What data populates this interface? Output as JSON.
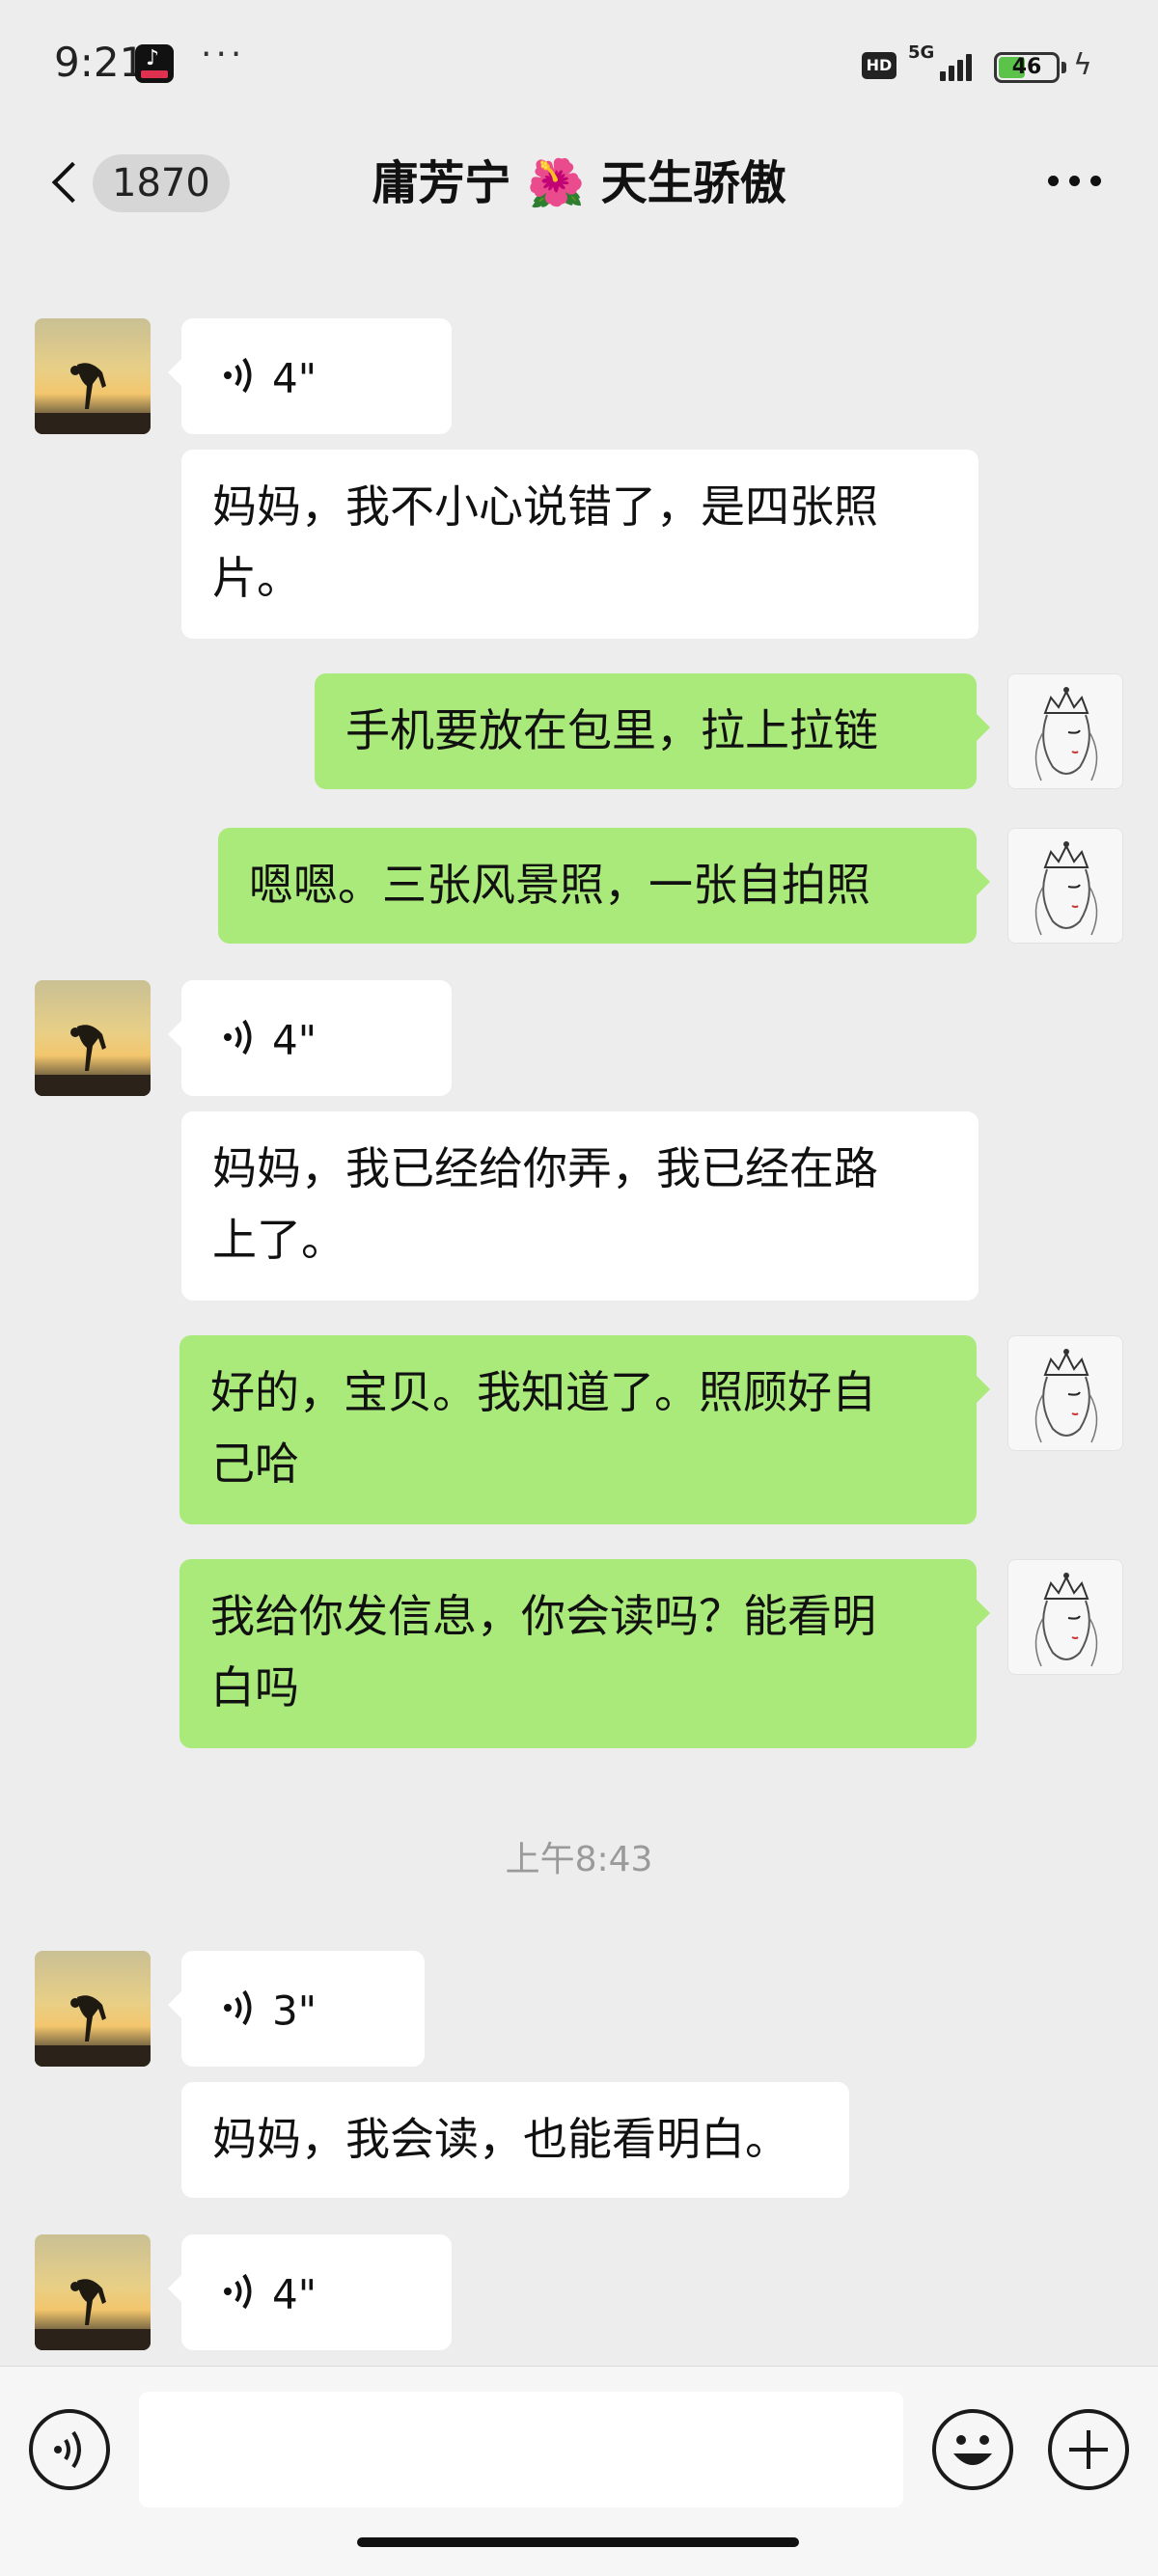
{
  "status_bar": {
    "time": "9:21",
    "dots": "···",
    "hd": "HD",
    "network": "5G",
    "battery": "46",
    "battery_level": 0.46
  },
  "header": {
    "unread_count": "1870",
    "title": "庸芳宁 🌺 天生骄傲"
  },
  "messages": [
    {
      "side": "in",
      "type": "voice",
      "duration": "4\""
    },
    {
      "side": "in",
      "type": "text",
      "lines": [
        "妈妈，我不小心说错了，是四张照",
        "片。"
      ]
    },
    {
      "side": "out",
      "type": "text",
      "lines": [
        "手机要放在包里，拉上拉链"
      ]
    },
    {
      "side": "out",
      "type": "text",
      "lines": [
        "嗯嗯。三张风景照，一张自拍照"
      ]
    },
    {
      "side": "in",
      "type": "voice",
      "duration": "4\""
    },
    {
      "side": "in",
      "type": "text",
      "lines": [
        "妈妈，我已经给你弄，我已经在路",
        "上了。"
      ]
    },
    {
      "side": "out",
      "type": "text",
      "lines": [
        "好的，宝贝。我知道了。照顾好自",
        "己哈"
      ]
    },
    {
      "side": "out",
      "type": "text",
      "lines": [
        "我给你发信息，你会读吗？能看明",
        "白吗"
      ]
    },
    {
      "side": "in",
      "type": "voice",
      "duration": "3\""
    },
    {
      "side": "in",
      "type": "text",
      "lines": [
        "妈妈，我会读，也能看明白。"
      ]
    },
    {
      "side": "in",
      "type": "voice",
      "duration": "4\""
    }
  ],
  "timestamp": "上午8:43",
  "input_bar": {
    "placeholder": ""
  },
  "colors": {
    "background": "#ededed",
    "outgoing_bubble": "#a9ea7a",
    "incoming_bubble": "#ffffff"
  }
}
